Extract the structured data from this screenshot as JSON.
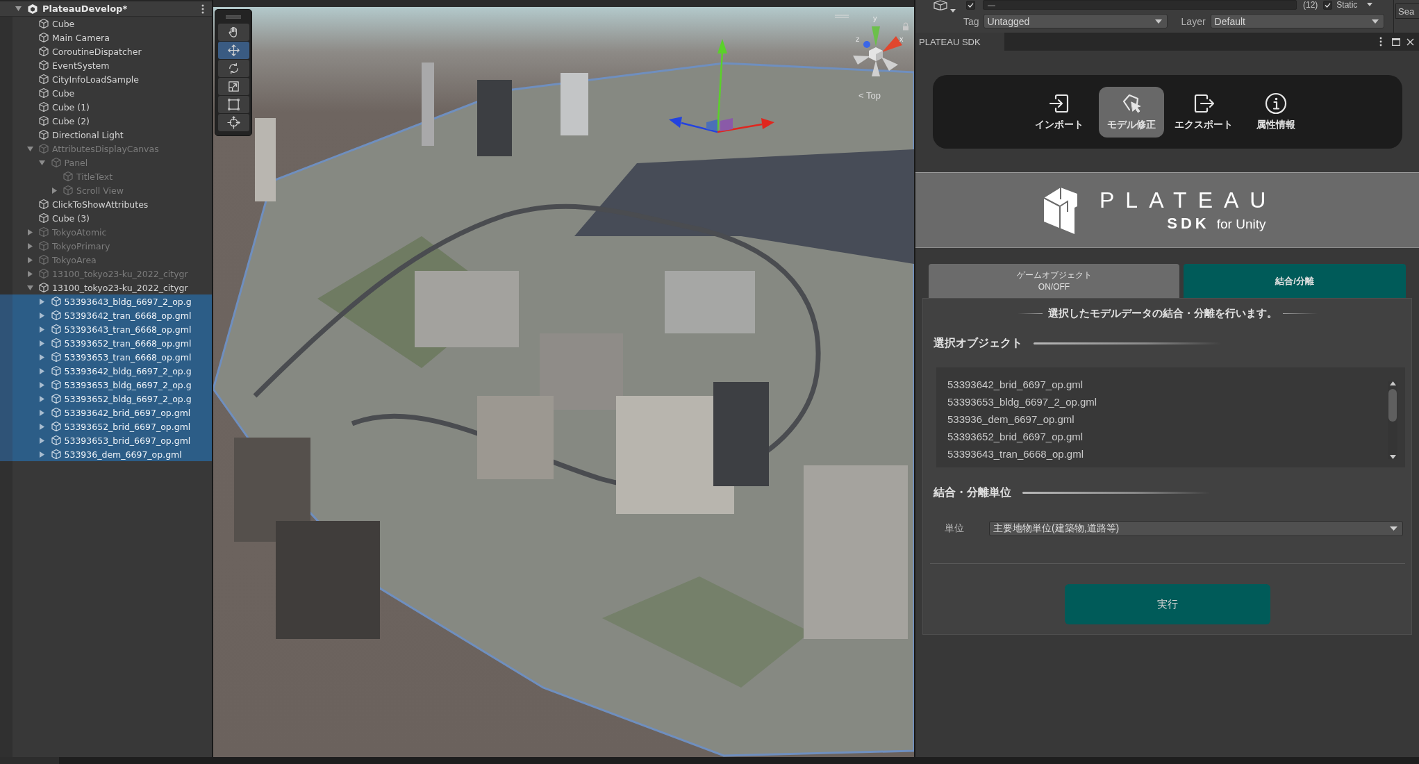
{
  "hierarchy": {
    "scene": "PlateauDevelop*",
    "expanded": true,
    "items": [
      {
        "name": "Cube",
        "active": true,
        "selected": false
      },
      {
        "name": "Main Camera",
        "active": true,
        "selected": false
      },
      {
        "name": "CoroutineDispatcher",
        "active": true,
        "selected": false
      },
      {
        "name": "EventSystem",
        "active": true,
        "selected": false
      },
      {
        "name": "CityInfoLoadSample",
        "active": true,
        "selected": false
      },
      {
        "name": "Cube",
        "active": true,
        "selected": false
      },
      {
        "name": "Cube (1)",
        "active": true,
        "selected": false
      },
      {
        "name": "Cube (2)",
        "active": true,
        "selected": false
      },
      {
        "name": "Directional Light",
        "active": true,
        "selected": false
      },
      {
        "name": "AttributesDisplayCanvas",
        "active": false,
        "selected": false,
        "expanded": true,
        "children": [
          {
            "name": "Panel",
            "active": false,
            "selected": false,
            "expanded": true,
            "children": [
              {
                "name": "TitleText",
                "active": false,
                "selected": false
              },
              {
                "name": "Scroll View",
                "active": false,
                "selected": false,
                "expanded": false
              }
            ]
          }
        ]
      },
      {
        "name": "ClickToShowAttributes",
        "active": true,
        "selected": false
      },
      {
        "name": "Cube (3)",
        "active": true,
        "selected": false
      },
      {
        "name": "TokyoAtomic",
        "active": false,
        "selected": false,
        "expanded": false
      },
      {
        "name": "TokyoPrimary",
        "active": false,
        "selected": false,
        "expanded": false
      },
      {
        "name": "TokyoArea",
        "active": false,
        "selected": false,
        "expanded": false
      },
      {
        "name": "13100_tokyo23-ku_2022_citygr",
        "active": false,
        "selected": false,
        "expanded": false
      },
      {
        "name": "13100_tokyo23-ku_2022_citygr",
        "active": true,
        "selected": false,
        "expanded": true,
        "children": [
          {
            "name": "53393643_bldg_6697_2_op.g",
            "active": true,
            "selected": true,
            "expanded": false
          },
          {
            "name": "53393642_tran_6668_op.gml",
            "active": true,
            "selected": true,
            "expanded": false
          },
          {
            "name": "53393643_tran_6668_op.gml",
            "active": true,
            "selected": true,
            "expanded": false
          },
          {
            "name": "53393652_tran_6668_op.gml",
            "active": true,
            "selected": true,
            "expanded": false
          },
          {
            "name": "53393653_tran_6668_op.gml",
            "active": true,
            "selected": true,
            "expanded": false
          },
          {
            "name": "53393642_bldg_6697_2_op.g",
            "active": true,
            "selected": true,
            "expanded": false
          },
          {
            "name": "53393653_bldg_6697_2_op.g",
            "active": true,
            "selected": true,
            "expanded": false
          },
          {
            "name": "53393652_bldg_6697_2_op.g",
            "active": true,
            "selected": true,
            "expanded": false
          },
          {
            "name": "53393642_brid_6697_op.gml",
            "active": true,
            "selected": true,
            "expanded": false
          },
          {
            "name": "53393652_brid_6697_op.gml",
            "active": true,
            "selected": true,
            "expanded": false
          },
          {
            "name": "53393653_brid_6697_op.gml",
            "active": true,
            "selected": true,
            "expanded": false
          },
          {
            "name": "533936_dem_6697_op.gml",
            "active": true,
            "selected": true,
            "expanded": false
          }
        ]
      }
    ]
  },
  "scene_view": {
    "tools": [
      {
        "kind": "hand",
        "selected": false
      },
      {
        "kind": "move",
        "selected": true
      },
      {
        "kind": "rotate",
        "selected": false
      },
      {
        "kind": "scale",
        "selected": false
      },
      {
        "kind": "rect",
        "selected": false
      },
      {
        "kind": "transform",
        "selected": false
      }
    ],
    "gizmo": {
      "axes": [
        {
          "kind": "y",
          "label": "y"
        },
        {
          "kind": "z",
          "label": "z"
        },
        {
          "kind": "x",
          "label": "x"
        }
      ],
      "view_label": "< Top"
    }
  },
  "inspector": {
    "enabled": true,
    "name_value": "—",
    "count": "(12)",
    "static": {
      "label": "Static",
      "checked": true
    },
    "tag": {
      "label": "Tag",
      "value": "Untagged"
    },
    "layer": {
      "label": "Layer",
      "value": "Default"
    }
  },
  "search_field": {
    "label": "Sea"
  },
  "sdk_window": {
    "title": "PLATEAU SDK",
    "toolbar": [
      {
        "kind": "import",
        "label": "インポート",
        "selected": false
      },
      {
        "kind": "edit",
        "label": "モデル修正",
        "selected": true
      },
      {
        "kind": "export",
        "label": "エクスポート",
        "selected": false
      },
      {
        "kind": "info",
        "label": "属性情報",
        "selected": false
      }
    ],
    "logo": {
      "title": "PLATEAU",
      "subtitle": "SDK",
      "suffix": "for Unity"
    },
    "tabs": [
      {
        "label": "ゲームオブジェクト\nON/OFF",
        "selected": false
      },
      {
        "label": "結合/分離",
        "selected": true
      }
    ],
    "description": "選択したモデルデータの結合・分離を行います。",
    "selected_objects": {
      "heading": "選択オブジェクト",
      "items": [
        "53393642_brid_6697_op.gml",
        "53393653_bldg_6697_2_op.gml",
        "533936_dem_6697_op.gml",
        "53393652_brid_6697_op.gml",
        "53393643_tran_6668_op.gml"
      ]
    },
    "unit": {
      "heading": "結合・分離単位",
      "label": "単位",
      "value": "主要地物単位(建築物,道路等)"
    },
    "run_button": "実行"
  }
}
